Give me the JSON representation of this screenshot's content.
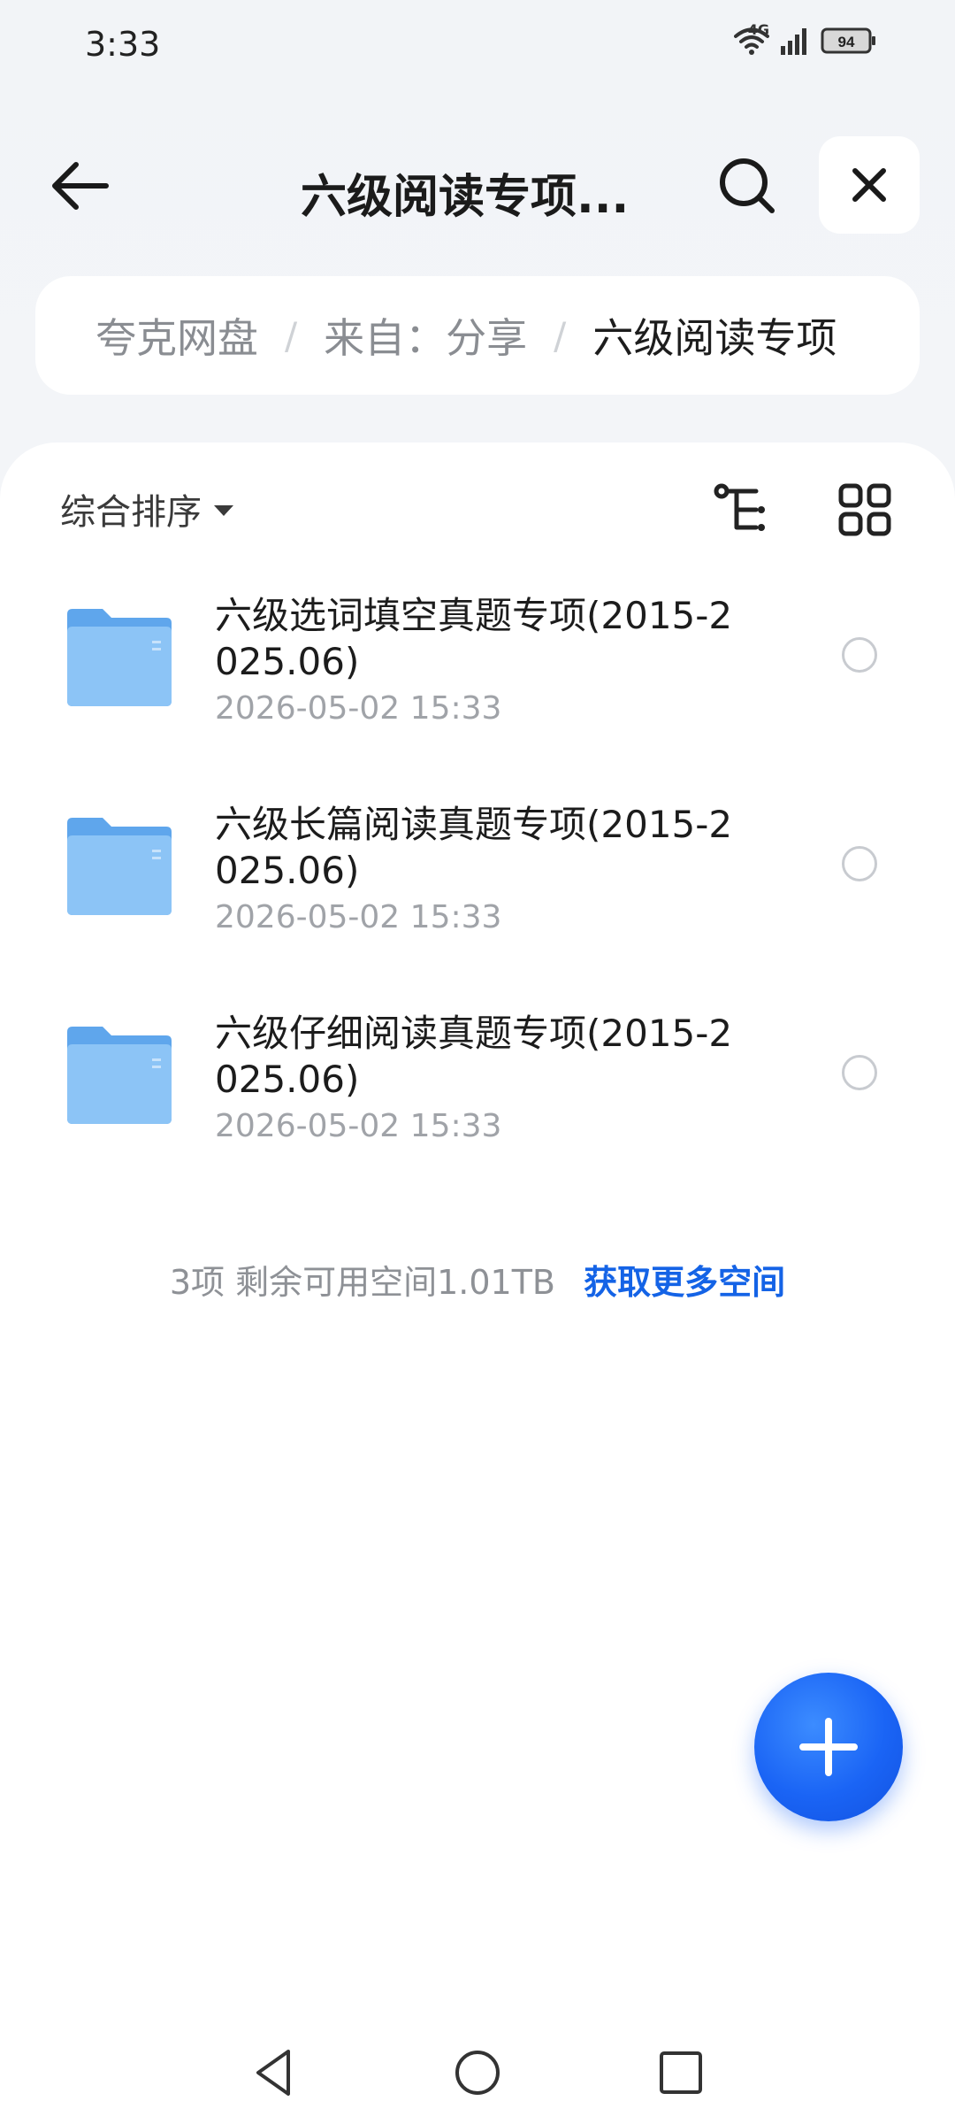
{
  "status_bar": {
    "time": "3:33",
    "network": "4G",
    "battery": "94",
    "icons": [
      "wifi-icon",
      "signal-icon",
      "battery-icon"
    ]
  },
  "header": {
    "title": "六级阅读专项...",
    "back_icon": "arrow-left-icon",
    "search_icon": "search-icon",
    "close_icon": "close-icon"
  },
  "breadcrumb": {
    "items": [
      "夸克网盘",
      "来自：分享",
      "六级阅读专项"
    ],
    "separator": "/"
  },
  "toolbar": {
    "sort_label": "综合排序",
    "tree_icon": "tree-view-icon",
    "grid_icon": "grid-view-icon"
  },
  "files": [
    {
      "name": "六级选词填空真题专项(2015-2025.06)",
      "date": "2026-05-02 15:33",
      "icon": "folder-icon"
    },
    {
      "name": "六级长篇阅读真题专项(2015-2025.06)",
      "date": "2026-05-02 15:33",
      "icon": "folder-icon"
    },
    {
      "name": "六级仔细阅读真题专项(2015-2025.06)",
      "date": "2026-05-02 15:33",
      "icon": "folder-icon"
    }
  ],
  "footer": {
    "storage_text": "3项 剩余可用空间1.01TB",
    "more_space_link": "获取更多空间"
  },
  "fab": {
    "icon": "plus-icon"
  },
  "colors": {
    "accent": "#1463e6",
    "fab": "#1a64f5",
    "folder": "#7cb8f2",
    "background": "#f3f5f8"
  }
}
